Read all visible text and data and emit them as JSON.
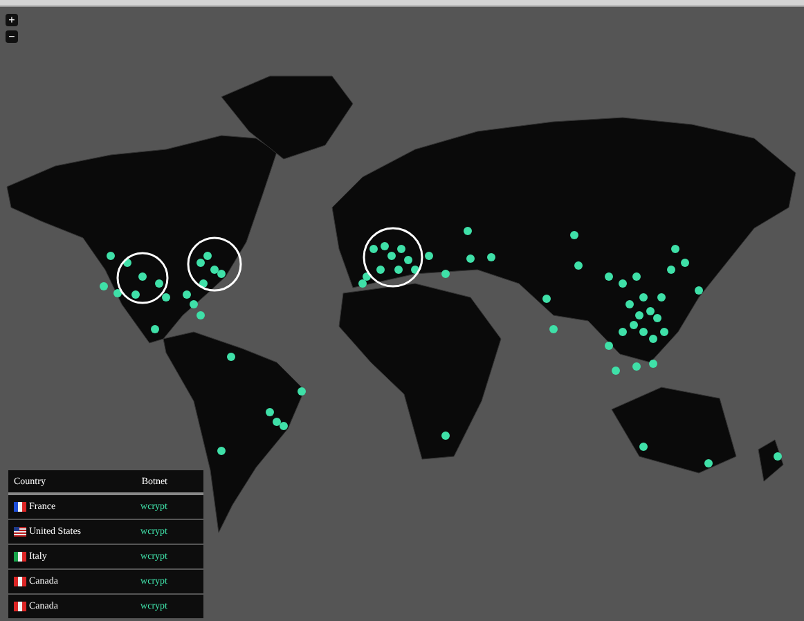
{
  "zoom_controls": [
    "+",
    "−"
  ],
  "table": {
    "columns": [
      "Country",
      "Botnet"
    ],
    "rows": [
      {
        "country": "France",
        "kind": "fr",
        "botnet": "wcrypt"
      },
      {
        "country": "United States",
        "kind": "us",
        "botnet": "wcrypt"
      },
      {
        "country": "Italy",
        "kind": "it",
        "botnet": "wcrypt"
      },
      {
        "country": "Canada",
        "kind": "ca",
        "botnet": "wcrypt"
      },
      {
        "country": "Canada",
        "kind": "ca",
        "botnet": "wcrypt"
      }
    ]
  }
}
